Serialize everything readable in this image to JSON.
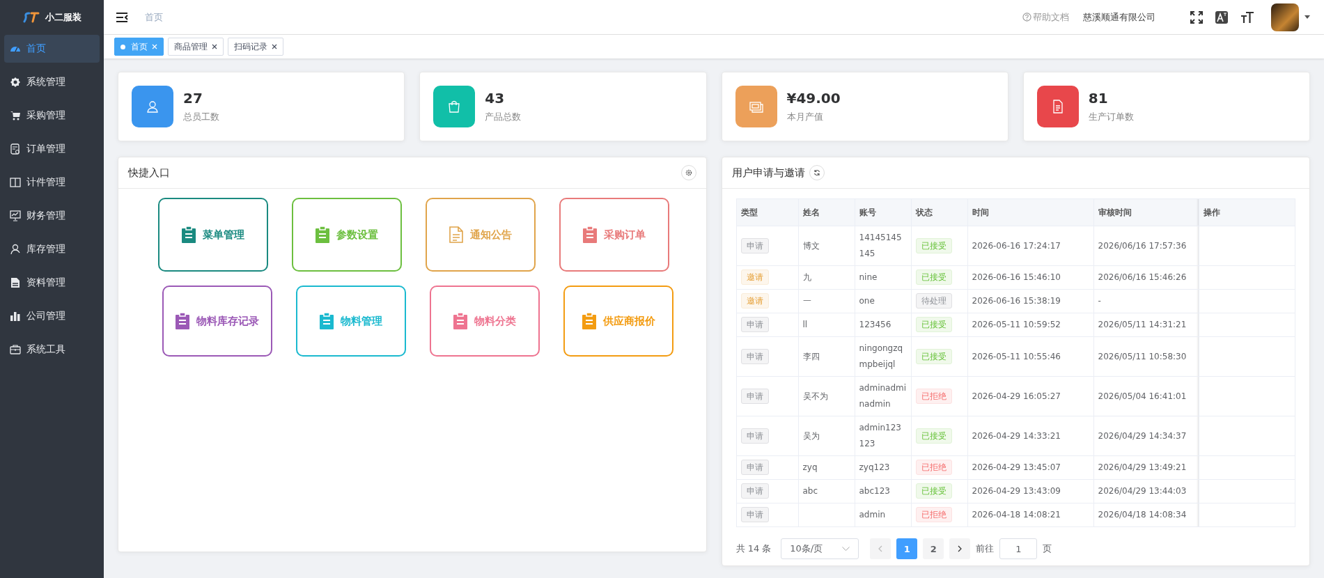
{
  "sidebar": {
    "logo": "小二服装",
    "items": [
      {
        "label": "首页",
        "selected": true
      },
      {
        "label": "系统管理",
        "selected": false
      },
      {
        "label": "采购管理",
        "selected": false
      },
      {
        "label": "订单管理",
        "selected": false
      },
      {
        "label": "计件管理",
        "selected": false
      },
      {
        "label": "财务管理",
        "selected": false
      },
      {
        "label": "库存管理",
        "selected": false
      },
      {
        "label": "资料管理",
        "selected": false
      },
      {
        "label": "公司管理",
        "selected": false
      },
      {
        "label": "系统工具",
        "selected": false
      }
    ]
  },
  "header": {
    "breadcrumb": "首页",
    "help": "帮助文档",
    "company": "慈溪顺通有限公司"
  },
  "tabs": [
    {
      "label": "首页",
      "selected": true
    },
    {
      "label": "商品管理",
      "selected": false
    },
    {
      "label": "扫码记录",
      "selected": false
    }
  ],
  "stats": [
    {
      "value": "27",
      "label": "总员工数",
      "color": "#3a95ee"
    },
    {
      "value": "43",
      "label": "产品总数",
      "color": "#11bfa8"
    },
    {
      "value": "¥49.00",
      "label": "本月产值",
      "color": "#eca05a"
    },
    {
      "value": "81",
      "label": "生产订单数",
      "color": "#e8474b"
    }
  ],
  "quick_entry": {
    "title": "快捷入口",
    "items": [
      {
        "label": "菜单管理",
        "color": "#1a8a80",
        "kind": "clipboard"
      },
      {
        "label": "参数设置",
        "color": "#6cbf3f",
        "kind": "clipboard"
      },
      {
        "label": "通知公告",
        "color": "#e0a44a",
        "kind": "document"
      },
      {
        "label": "采购订单",
        "color": "#e87a7a",
        "kind": "clipboard"
      },
      {
        "label": "物料库存记录",
        "color": "#9b59b6",
        "kind": "clipboard"
      },
      {
        "label": "物料管理",
        "color": "#1ab9cf",
        "kind": "clipboard"
      },
      {
        "label": "物料分类",
        "color": "#ee7490",
        "kind": "clipboard"
      },
      {
        "label": "供应商报价",
        "color": "#f39c12",
        "kind": "clipboard"
      }
    ]
  },
  "requests": {
    "title": "用户申请与邀请",
    "table": {
      "columns": [
        "类型",
        "姓名",
        "账号",
        "状态",
        "时间",
        "审核时间",
        "操作"
      ],
      "rows": [
        {
          "type": {
            "text": "申请",
            "kind": "apply"
          },
          "name": "博文",
          "account": "14145145145",
          "status": {
            "text": "已接受",
            "kind": "accepted"
          },
          "time": "2026-06-16 17:24:17",
          "review_time": "2026/06/16 17:57:36"
        },
        {
          "type": {
            "text": "邀请",
            "kind": "invite"
          },
          "name": "九",
          "account": "nine",
          "status": {
            "text": "已接受",
            "kind": "accepted"
          },
          "time": "2026-06-16 15:46:10",
          "review_time": "2026/06/16 15:46:26"
        },
        {
          "type": {
            "text": "邀请",
            "kind": "invite"
          },
          "name": "一",
          "account": "one",
          "status": {
            "text": "待处理",
            "kind": "pending"
          },
          "time": "2026-06-16 15:38:19",
          "review_time": "-"
        },
        {
          "type": {
            "text": "申请",
            "kind": "apply"
          },
          "name": "ll",
          "account": "123456",
          "status": {
            "text": "已接受",
            "kind": "accepted"
          },
          "time": "2026-05-11 10:59:52",
          "review_time": "2026/05/11 14:31:21"
        },
        {
          "type": {
            "text": "申请",
            "kind": "apply"
          },
          "name": "李四",
          "account": "ningongzqmpbeijql",
          "status": {
            "text": "已接受",
            "kind": "accepted"
          },
          "time": "2026-05-11 10:55:46",
          "review_time": "2026/05/11 10:58:30"
        },
        {
          "type": {
            "text": "申请",
            "kind": "apply"
          },
          "name": "吴不为",
          "account": "adminadminadmin",
          "status": {
            "text": "已拒绝",
            "kind": "rejected"
          },
          "time": "2026-04-29 16:05:27",
          "review_time": "2026/05/04 16:41:01"
        },
        {
          "type": {
            "text": "申请",
            "kind": "apply"
          },
          "name": "吴为",
          "account": "admin123123",
          "status": {
            "text": "已接受",
            "kind": "accepted"
          },
          "time": "2026-04-29 14:33:21",
          "review_time": "2026/04/29 14:34:37"
        },
        {
          "type": {
            "text": "申请",
            "kind": "apply"
          },
          "name": "zyq",
          "account": "zyq123",
          "status": {
            "text": "已拒绝",
            "kind": "rejected"
          },
          "time": "2026-04-29 13:45:07",
          "review_time": "2026/04/29 13:49:21"
        },
        {
          "type": {
            "text": "申请",
            "kind": "apply"
          },
          "name": "abc",
          "account": "abc123",
          "status": {
            "text": "已接受",
            "kind": "accepted"
          },
          "time": "2026-04-29 13:43:09",
          "review_time": "2026/04/29 13:44:03"
        },
        {
          "type": {
            "text": "申请",
            "kind": "apply"
          },
          "account": "admin",
          "status": {
            "text": "已拒绝",
            "kind": "rejected"
          },
          "time": "2026-04-18 14:08:21",
          "review_time": "2026/04/18 14:08:34"
        }
      ]
    },
    "pagination": {
      "total": "共 14 条",
      "page_size": "10条/页",
      "pages": [
        {
          "label": "1",
          "selected": true
        },
        {
          "label": "2",
          "selected": false
        }
      ],
      "goto_label": "前往",
      "goto_value": "1",
      "page_suffix": "页"
    }
  }
}
